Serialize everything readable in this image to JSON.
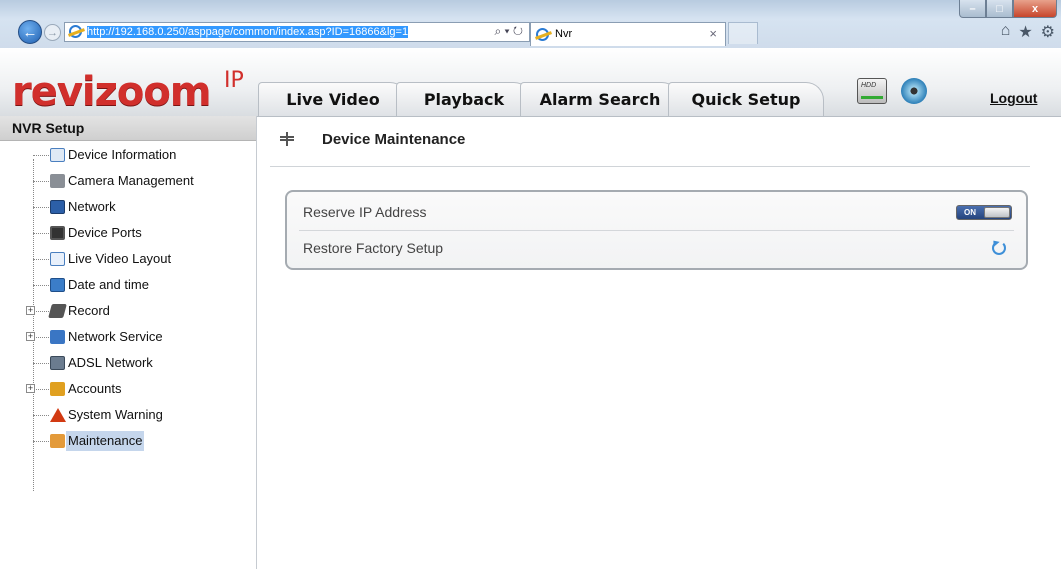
{
  "browser": {
    "url_prefix": "http://192.168.0.250/asp",
    "url_rest": "page/common/index.asp?ID=16866&lg=1",
    "address_tools": "⌕ ▾ ↻",
    "tab_title": "Nvr",
    "tab_close": "×",
    "window_buttons": {
      "minimize": "–",
      "maximize": "□",
      "close": "x"
    },
    "right_icons": [
      "⌂",
      "★",
      "⚙"
    ]
  },
  "app": {
    "logo": "revizoom",
    "logo_sup": "IP",
    "tabs": [
      {
        "label": "Live Video"
      },
      {
        "label": "Playback"
      },
      {
        "label": "Alarm Search"
      },
      {
        "label": "Quick Setup"
      }
    ],
    "hdd_label": "HDD",
    "logout": "Logout"
  },
  "sidebar": {
    "title": "NVR Setup",
    "items": [
      {
        "label": "Device Information",
        "icon": "info-icon",
        "expandable": false
      },
      {
        "label": "Camera Management",
        "icon": "camera-icon",
        "expandable": false
      },
      {
        "label": "Network",
        "icon": "network-icon",
        "expandable": false
      },
      {
        "label": "Device Ports",
        "icon": "ports-icon",
        "expandable": false
      },
      {
        "label": "Live Video Layout",
        "icon": "layout-icon",
        "expandable": false
      },
      {
        "label": "Date and time",
        "icon": "calendar-icon",
        "expandable": false
      },
      {
        "label": "Record",
        "icon": "record-icon",
        "expandable": true
      },
      {
        "label": "Network Service",
        "icon": "network-service-icon",
        "expandable": true
      },
      {
        "label": "ADSL Network",
        "icon": "adsl-icon",
        "expandable": false
      },
      {
        "label": "Accounts",
        "icon": "accounts-icon",
        "expandable": true
      },
      {
        "label": "System Warning",
        "icon": "warning-icon",
        "expandable": false
      },
      {
        "label": "Maintenance",
        "icon": "maintenance-icon",
        "expandable": false,
        "selected": true
      }
    ]
  },
  "main": {
    "title": "Device Maintenance",
    "rows": [
      {
        "label": "Reserve IP Address",
        "control": "toggle",
        "value": "ON"
      },
      {
        "label": "Restore Factory Setup",
        "control": "restore-icon"
      }
    ]
  },
  "colors": {
    "brand_red": "#d12f2c",
    "toggle_blue": "#25447d",
    "selection": "#c5d6ec"
  }
}
